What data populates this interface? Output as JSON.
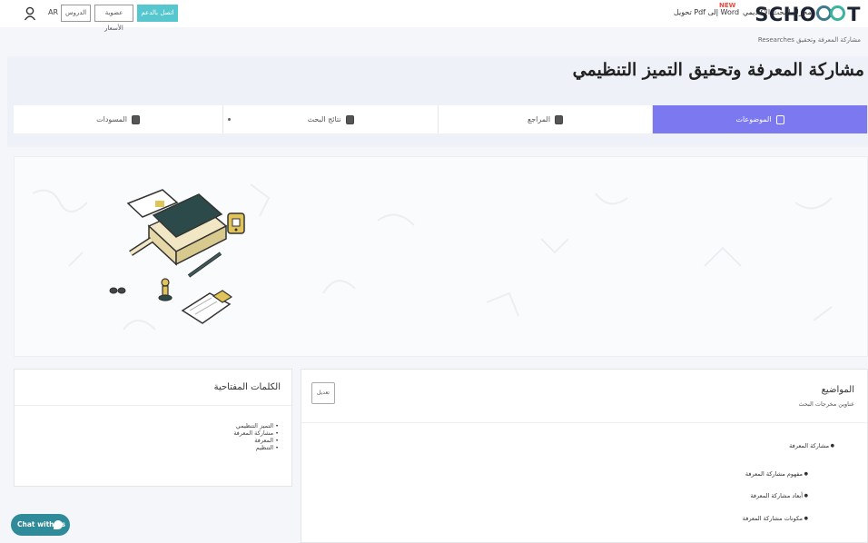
{
  "topbar": {
    "logo": "SCHO",
    "logo_tail": "T",
    "nav_research": "محرك البحث الأكاديمي",
    "nav_pdf": "تحويل Pdf إلى Word",
    "new_badge": "NEW",
    "contact_button": "اتصل بالدعم",
    "pricing_button": "عضوية الأسعار",
    "lessons_button": "الدروس",
    "language": "AR",
    "user_icon": "user-icon"
  },
  "breadcrumb": "Researches مشاركة المعرفة وتحقيق",
  "page_title": "مشاركة المعرفة وتحقيق التميز التنظيمي",
  "tabs": [
    {
      "label": "الموضوعات",
      "icon": "topics-icon",
      "active": true
    },
    {
      "label": "المراجع",
      "icon": "references-icon",
      "active": false
    },
    {
      "label": "نتائج البحث",
      "icon": "results-icon",
      "active": false
    },
    {
      "label": "المسودات",
      "icon": "drafts-icon",
      "active": false
    }
  ],
  "keywords": {
    "title": "الكلمات المفتاحية",
    "items": [
      "التميز التنظيمي",
      "مشاركة المعرفة",
      "المعرفة",
      "التنظيم"
    ]
  },
  "topics": {
    "title": "المواضيع",
    "subtitle": "عناوين مخرجات البحث",
    "edit_button": "تعديل",
    "items": [
      {
        "label": "مشاركة المعرفة"
      },
      {
        "label": "مفهوم مشاركة المعرفة"
      },
      {
        "label": "أبعاد مشاركة المعرفة"
      },
      {
        "label": "مكونات مشاركة المعرفة"
      }
    ]
  },
  "chat": {
    "label": "Chat with us"
  },
  "colors": {
    "accent": "#7b78f0",
    "contact": "#56c7ce",
    "chat": "#2f8a99",
    "badge": "#e74c3c"
  }
}
